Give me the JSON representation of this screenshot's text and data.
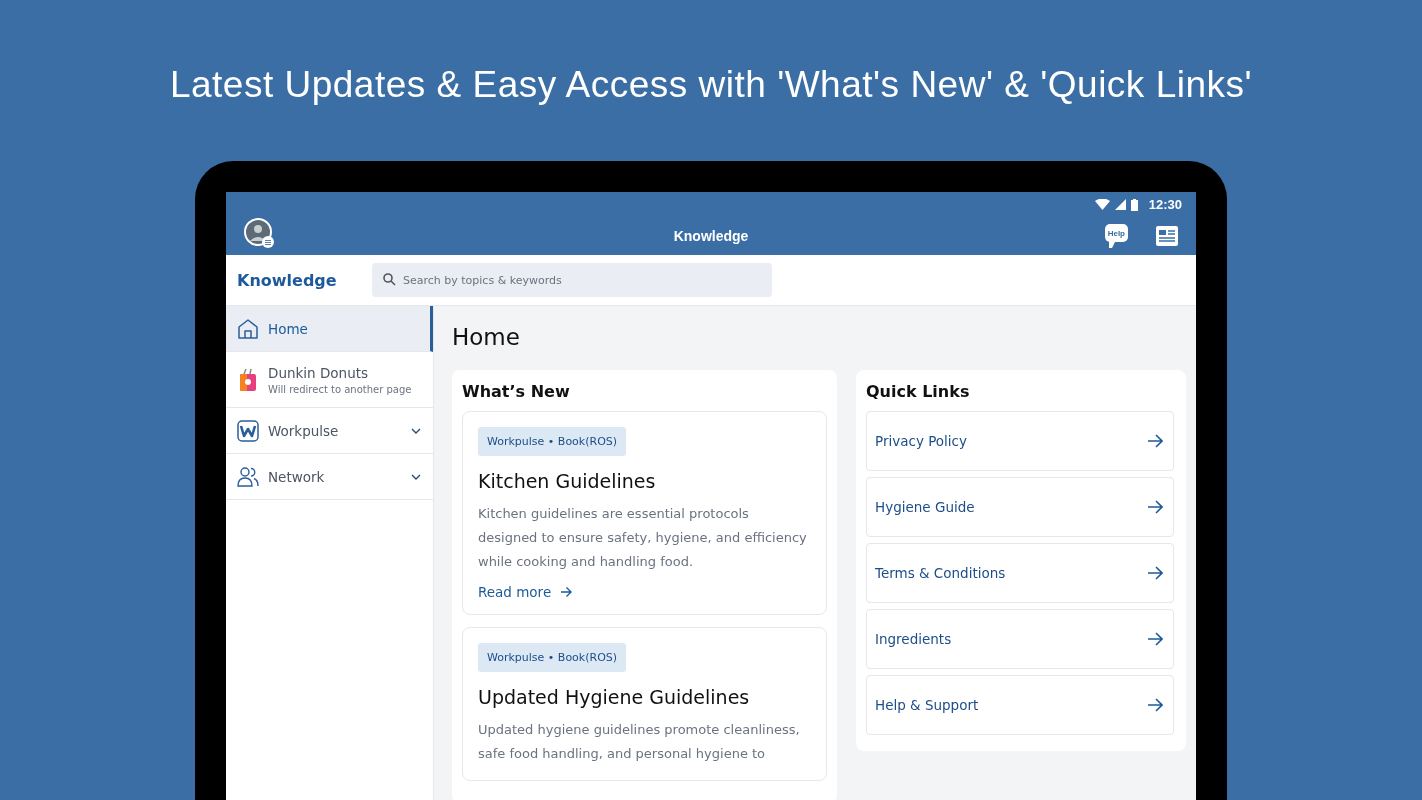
{
  "headline": "Latest Updates & Easy Access with 'What's New' & 'Quick Links'",
  "status_bar": {
    "time": "12:30"
  },
  "app_bar": {
    "title": "Knowledge",
    "help_icon_label": "Help"
  },
  "subheader": {
    "title": "Knowledge",
    "search": {
      "placeholder": "Search by topics & keywords"
    }
  },
  "sidebar": {
    "items": [
      {
        "kind": "home",
        "label": "Home",
        "selected": true
      },
      {
        "kind": "external",
        "label": "Dunkin Donuts",
        "subtitle": "Will redirect to another page",
        "selected": false
      },
      {
        "kind": "workpulse",
        "label": "Workpulse",
        "selected": false,
        "expanded": false
      },
      {
        "kind": "network",
        "label": "Network",
        "selected": false,
        "expanded": false
      }
    ]
  },
  "page": {
    "title": "Home",
    "whats_new": {
      "title": "What’s New",
      "cards": [
        {
          "tag": "Workpulse • Book(ROS)",
          "title": "Kitchen Guidelines",
          "body": "Kitchen guidelines are essential protocols designed to ensure safety, hygiene, and efficiency while cooking and handling food.",
          "link": "Read more"
        },
        {
          "tag": "Workpulse • Book(ROS)",
          "title": "Updated Hygiene Guidelines",
          "body": "Updated hygiene guidelines promote cleanliness, safe food handling, and personal hygiene to"
        }
      ]
    },
    "quick_links": {
      "title": "Quick Links",
      "items": [
        "Privacy Policy",
        "Hygiene Guide",
        "Terms & Conditions",
        "Ingredients",
        "Help & Support"
      ]
    }
  }
}
